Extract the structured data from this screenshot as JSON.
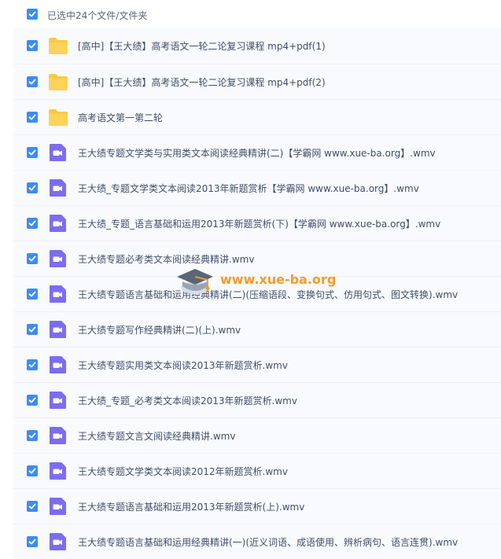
{
  "header": {
    "selected_text": "已选中24个文件/文件夹"
  },
  "files": [
    {
      "type": "folder",
      "name": "[高中]【王大绩】高考语文一轮二论复习课程 mp4+pdf(1)"
    },
    {
      "type": "folder",
      "name": "[高中]【王大绩】高考语文一轮二论复习课程 mp4+pdf(2)"
    },
    {
      "type": "folder",
      "name": "高考语文第一第二轮"
    },
    {
      "type": "video",
      "name": "王大绩专题文学类与实用类文本阅读经典精讲(二)【学霸网 www.xue-ba.org】.wmv"
    },
    {
      "type": "video",
      "name": "王大绩_专题文学类文本阅读2013年新题赏析【学霸网 www.xue-ba.org】.wmv"
    },
    {
      "type": "video",
      "name": "王大绩_专题_语言基础和运用2013年新题赏析(下)【学霸网 www.xue-ba.org】.wmv"
    },
    {
      "type": "video",
      "name": "王大绩专题必考类文本阅读经典精讲.wmv"
    },
    {
      "type": "video",
      "name": "王大绩专题语言基础和运用经典精讲(二)(压缩语段、变换句式、仿用句式、图文转换).wmv"
    },
    {
      "type": "video",
      "name": "王大绩专题写作经典精讲(二)(上).wmv"
    },
    {
      "type": "video",
      "name": "王大绩专题实用类文本阅读2013年新题赏析.wmv"
    },
    {
      "type": "video",
      "name": "王大绩_专题_必考类文本阅读2013年新题赏析.wmv"
    },
    {
      "type": "video",
      "name": "王大绩专题文言文阅读经典精讲.wmv"
    },
    {
      "type": "video",
      "name": "王大绩专题文学类文本阅读2012年新题赏析.wmv"
    },
    {
      "type": "video",
      "name": "王大绩专题语言基础和运用2013年新题赏析(上).wmv"
    },
    {
      "type": "video",
      "name": "王大绩专题语言基础和运用经典精讲(一)(近义词语、成语使用、辨析病句、语言连贯).wmv"
    }
  ],
  "watermark": {
    "text": "www.xue-ba.org"
  },
  "colors": {
    "checkbox": "#3b8cf5",
    "folder": "#ffc843",
    "video": "#7c6cf0",
    "watermark": "#f39b2e"
  }
}
